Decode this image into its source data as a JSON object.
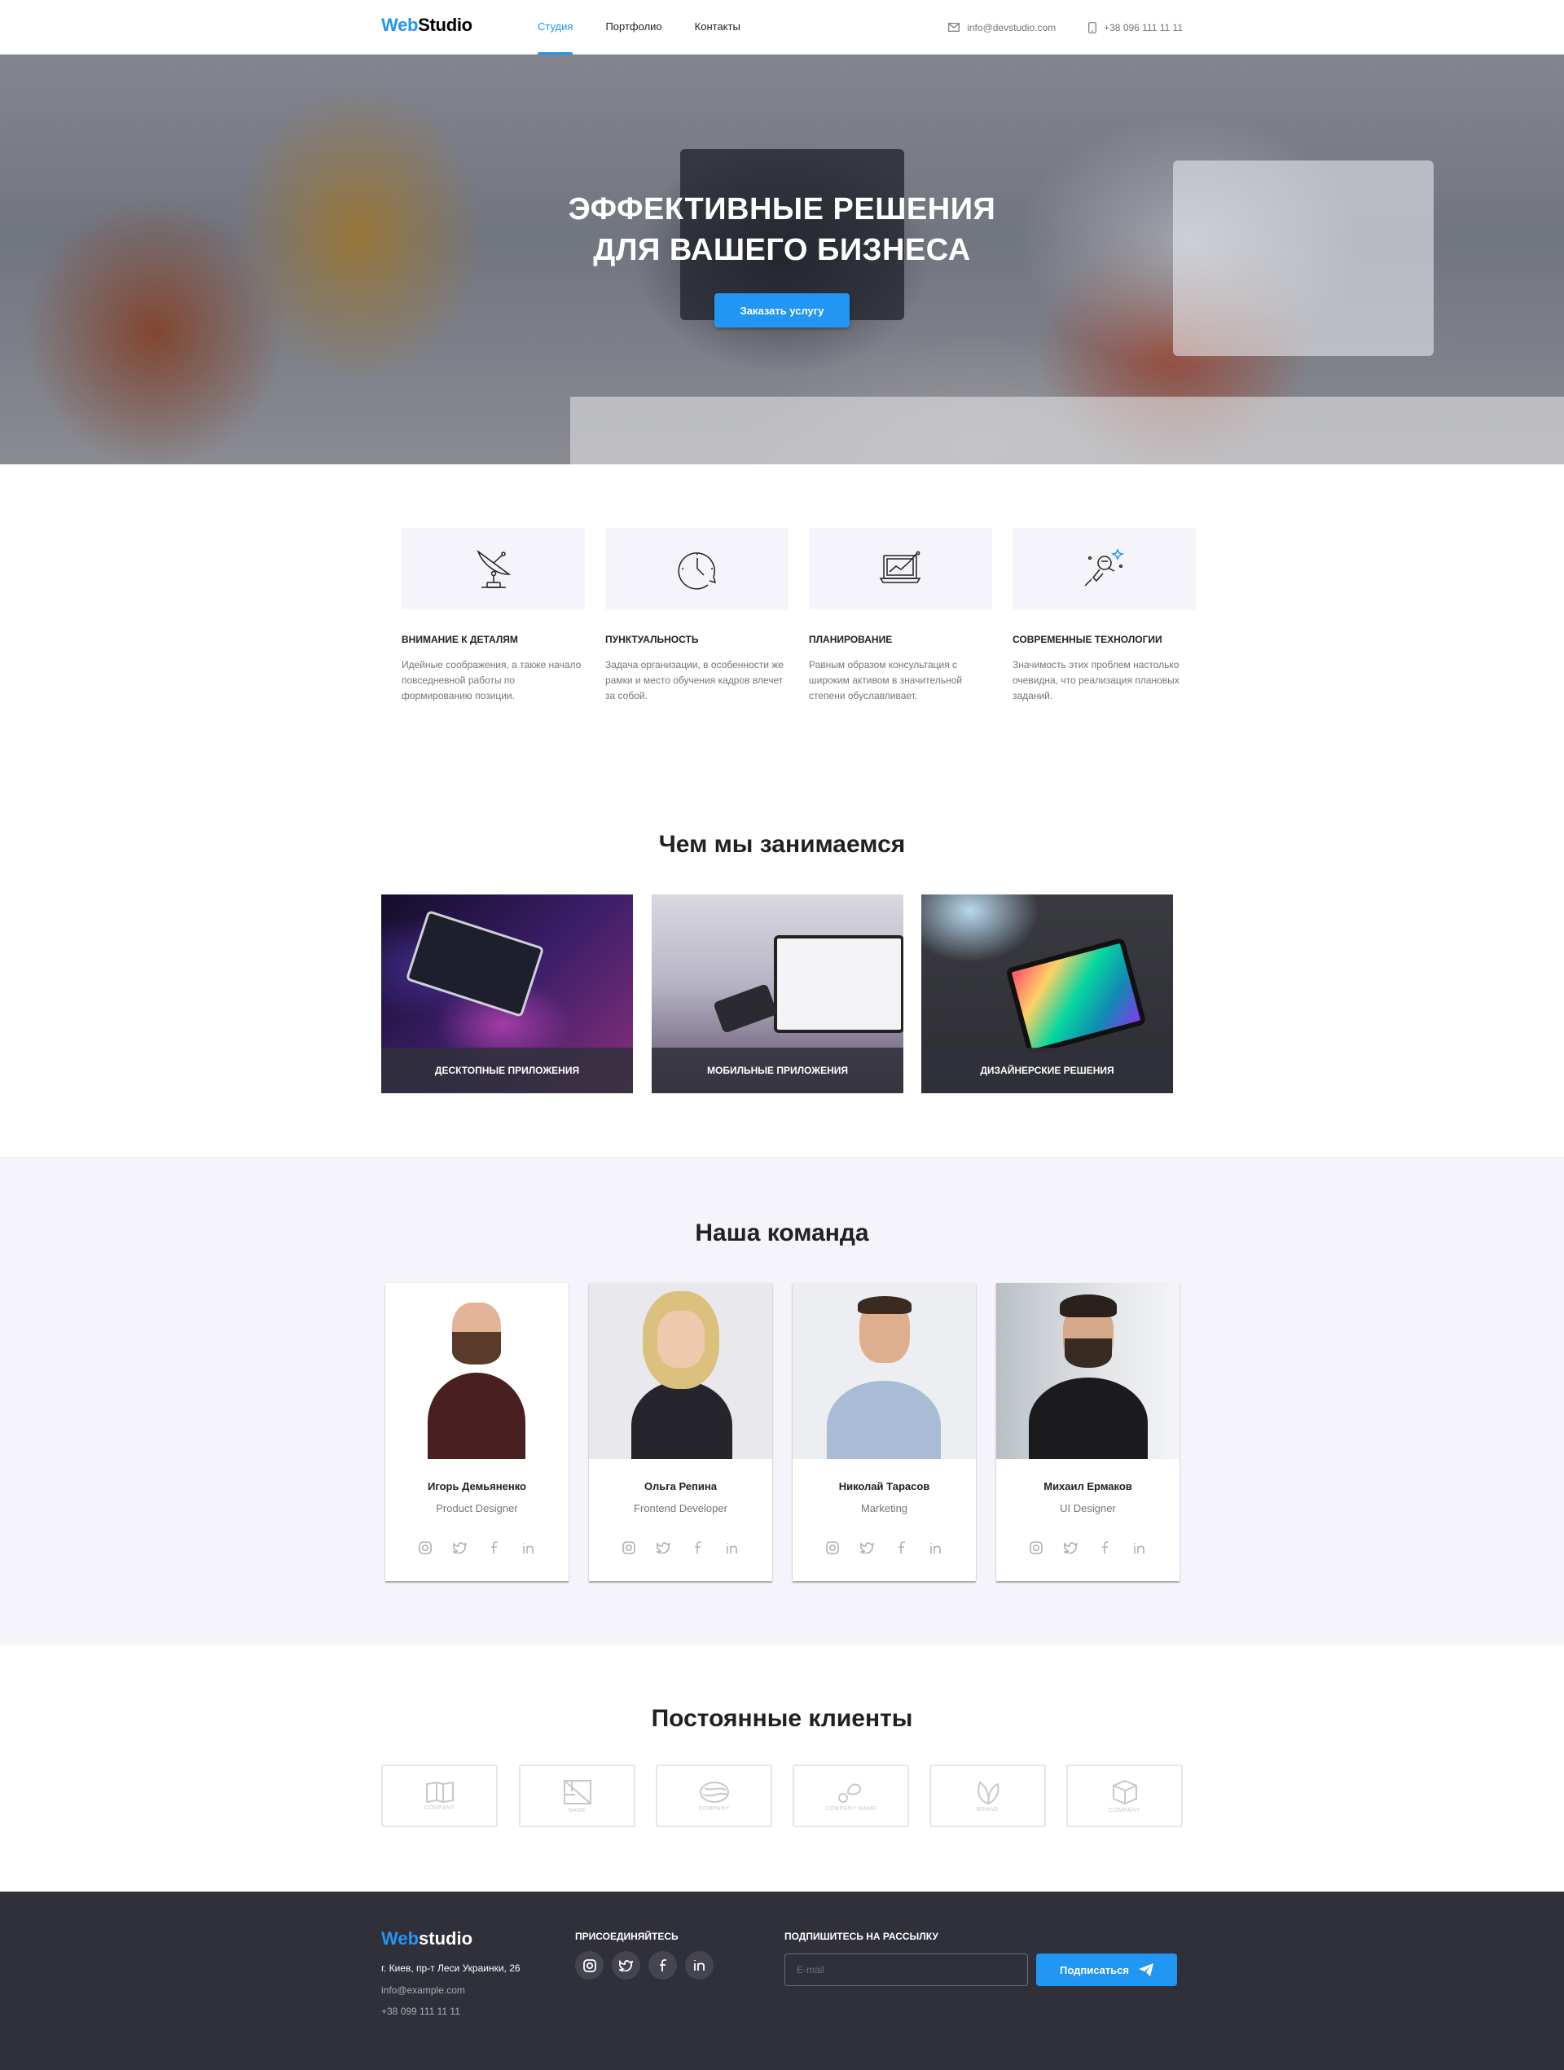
{
  "header": {
    "logo_part1": "Web",
    "logo_part2": "Studio",
    "nav": [
      {
        "label": "Студия",
        "active": true
      },
      {
        "label": "Портфолио",
        "active": false
      },
      {
        "label": "Контакты",
        "active": false
      }
    ],
    "email": "info@devstudio.com",
    "phone": "+38 096 111 11 11"
  },
  "hero": {
    "title_line1": "Эффективные решения",
    "title_line2": "для вашего бизнеса",
    "button": "Заказать услугу"
  },
  "features": [
    {
      "icon": "antenna-icon",
      "title": "Внимание к деталям",
      "text": "Идейные соображения, а также начало повседневной работы по формированию позиции."
    },
    {
      "icon": "clock-icon",
      "title": "Пунктуальность",
      "text": "Задача организации, в особенности же рамки и место обучения кадров влечет за собой."
    },
    {
      "icon": "laptop-chart-icon",
      "title": "Планирование",
      "text": "Равным образом консультация с широким активом в значительной степени обуславливает."
    },
    {
      "icon": "astronaut-icon",
      "title": "Современные технологии",
      "text": "Значимость этих проблем настолько очевидна, что реализация плановых заданий."
    }
  ],
  "services": {
    "title": "Чем мы занимаемся",
    "items": [
      {
        "label": "Десктопные приложения"
      },
      {
        "label": "Мобильные приложения"
      },
      {
        "label": "Дизайнерские решения"
      }
    ]
  },
  "team": {
    "title": "Наша команда",
    "members": [
      {
        "name": "Игорь Демьяненко",
        "role": "Product Designer"
      },
      {
        "name": "Ольга Репина",
        "role": "Frontend Developer"
      },
      {
        "name": "Николай Тарасов",
        "role": "Marketing"
      },
      {
        "name": "Михаил Ермаков",
        "role": "UI Designer"
      }
    ],
    "social_icons": [
      "instagram-icon",
      "twitter-icon",
      "facebook-icon",
      "linkedin-icon"
    ]
  },
  "clients": {
    "title": "Постоянные клиенты",
    "logos": [
      {
        "icon": "book-logo-icon",
        "label": "COMPANY"
      },
      {
        "icon": "square-logo-icon",
        "label": "NAME"
      },
      {
        "icon": "circle-logo-icon",
        "label": "COMPANY"
      },
      {
        "icon": "drops-logo-icon",
        "label": "COMPANY NAME"
      },
      {
        "icon": "leaf-logo-icon",
        "label": "BRAND"
      },
      {
        "icon": "cube-logo-icon",
        "label": "COMPANY"
      }
    ]
  },
  "footer": {
    "logo_part1": "Web",
    "logo_part2": "studio",
    "address": "г. Киев, пр-т Леси Украинки, 26",
    "email": "info@example.com",
    "phone": "+38 099 111 11 11",
    "join_title": "Присоединяйтесь",
    "subscribe_title": "Подпишитесь на рассылку",
    "email_placeholder": "E-mail",
    "subscribe_button": "Подписаться"
  },
  "colors": {
    "accent": "#2196f3",
    "footer_bg": "#2f303a",
    "section_bg": "#f5f4fa",
    "text": "#212121",
    "muted": "#757575"
  }
}
